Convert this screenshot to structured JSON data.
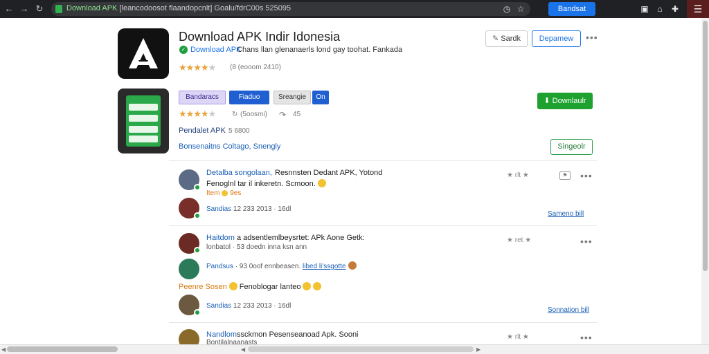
{
  "browser": {
    "url_host": "Download APK",
    "url_rest": " [leancodoosot flaandopcnlt] Goalu/fdrC00s 525095",
    "extension_label": "Bandsat",
    "colors": {
      "chrome_bg": "#202124",
      "accent": "#1a73e8",
      "menu_bg": "#5a1e1e"
    }
  },
  "header": {
    "app_title": "Download APK Indir Idonesia",
    "developer_name": "Download APK",
    "developer_desc": "Chans llan glenanaerls lond gay toohat. Fankada",
    "rating_text": "(8 (eooom 2410)",
    "share_label": "Sardk",
    "follow_label": "Depamew"
  },
  "app_info": {
    "chips": [
      "Bandaracs",
      "Fiaduo",
      "Sreangie",
      "On"
    ],
    "rating_count": "(5oosmi)",
    "rating_extra": "45",
    "download_label": "Downlaulr",
    "file_line": "Pendalet APK",
    "file_size": "5 6800",
    "category_line": "Bonsenaitns Coltago, Snengly",
    "share_button": "Singeolr"
  },
  "comments": [
    {
      "author": "Detalba songolaan,",
      "title": "Resnnsten Dedant APK, Yotond",
      "body": "Fenoglnl tar il inkeretn. Scmoon.",
      "accent": "Item",
      "accent_count": "9es",
      "rating": "★ rlt ★",
      "reply": {
        "author": "Sandias",
        "meta": "12 233 2013 · 16dl"
      },
      "reply_link": "Sameno bill"
    },
    {
      "author": "Haitdom",
      "title": "a adsentlemlbeysrtet: APk Aone Getk:",
      "meta": "lonbatol · 53 doedn inna ksn ann",
      "rating": "★ ret ★",
      "reply": {
        "author": "Pandsus",
        "meta": "· 93 0oof ennbeasen.",
        "link": "libed li'ssgotte"
      },
      "accent_label": "Peenre Sosen",
      "accent_body": "Fenoblogar lanteo",
      "reply2": {
        "author": "Sandias",
        "meta": "12 233 2013 · 16dl"
      },
      "reply_link": "Sonnation bill"
    },
    {
      "author": "Nandlom",
      "title": "ssckmon Pesenseanoad Apk. Sooni",
      "meta": "Bontilalnaanasts",
      "rating": "★ rlt ★"
    }
  ]
}
